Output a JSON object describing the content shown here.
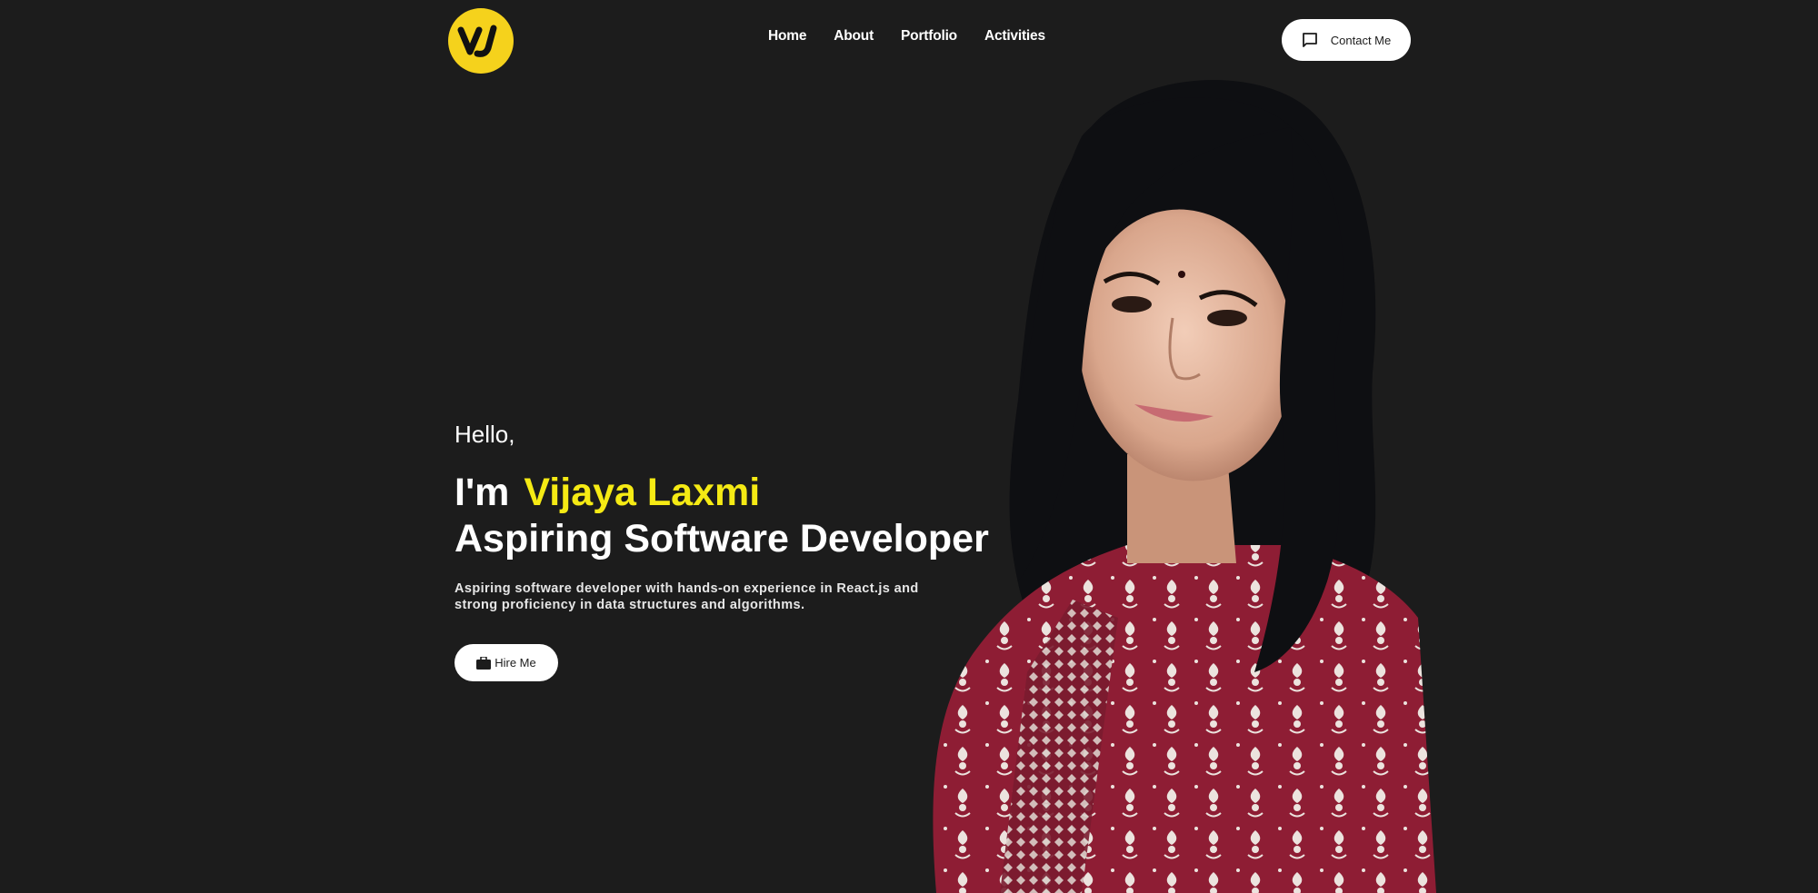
{
  "brand": {
    "logo_text": "VJ",
    "logo_color": "#f5d21c"
  },
  "nav": {
    "items": [
      {
        "label": "Home"
      },
      {
        "label": "About"
      },
      {
        "label": "Portfolio"
      },
      {
        "label": "Activities"
      }
    ]
  },
  "header": {
    "contact_label": "Contact Me",
    "contact_icon": "chat-icon"
  },
  "hero": {
    "greeting": "Hello,",
    "intro": "I'm",
    "name": "Vijaya Laxmi",
    "role": "Aspiring Software Developer",
    "bio_line1": "Aspiring software developer with hands-on experience in React.js and",
    "bio_line2": "strong proficiency in data structures and algorithms.",
    "hire_label": "Hire Me",
    "hire_icon": "briefcase-icon",
    "accent_color": "#f5ea14"
  },
  "theme": {
    "background": "#1c1c1c",
    "text": "#ffffff",
    "dress_color": "#8e1d34"
  }
}
